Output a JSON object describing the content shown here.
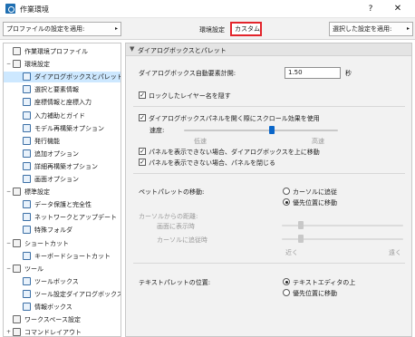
{
  "window": {
    "title": "作業環境",
    "help": "?",
    "close": "✕"
  },
  "toolbar": {
    "profile_button": "プロファイルの設定を適用:",
    "env_label": "環境設定",
    "env_value": "カスタム",
    "apply_button": "選択した設定を適用:",
    "arrow": "▸"
  },
  "tree": [
    {
      "label": "作業環境プロファイル",
      "indent": 0,
      "expander": "",
      "icon": true
    },
    {
      "label": "環境設定",
      "indent": 0,
      "expander": "−",
      "icon": true
    },
    {
      "label": "ダイアログボックスとパレット",
      "indent": 1,
      "expander": "",
      "icon": true,
      "selected": true
    },
    {
      "label": "選択と要素情報",
      "indent": 1,
      "expander": "",
      "icon": true
    },
    {
      "label": "座標情報と座標入力",
      "indent": 1,
      "expander": "",
      "icon": true
    },
    {
      "label": "入力補助とガイド",
      "indent": 1,
      "expander": "",
      "icon": true
    },
    {
      "label": "モデル再構築オプション",
      "indent": 1,
      "expander": "",
      "icon": true
    },
    {
      "label": "発行機能",
      "indent": 1,
      "expander": "",
      "icon": true
    },
    {
      "label": "追加オプション",
      "indent": 1,
      "expander": "",
      "icon": true
    },
    {
      "label": "詳細再構築オプション",
      "indent": 1,
      "expander": "",
      "icon": true
    },
    {
      "label": "画面オプション",
      "indent": 1,
      "expander": "",
      "icon": true
    },
    {
      "label": "標準設定",
      "indent": 0,
      "expander": "−",
      "icon": true
    },
    {
      "label": "データ保護と完全性",
      "indent": 1,
      "expander": "",
      "icon": true
    },
    {
      "label": "ネットワークとアップデート",
      "indent": 1,
      "expander": "",
      "icon": true
    },
    {
      "label": "特殊フォルダ",
      "indent": 1,
      "expander": "",
      "icon": true
    },
    {
      "label": "ショートカット",
      "indent": 0,
      "expander": "−",
      "icon": true
    },
    {
      "label": "キーボードショートカット",
      "indent": 1,
      "expander": "",
      "icon": true
    },
    {
      "label": "ツール",
      "indent": 0,
      "expander": "−",
      "icon": true
    },
    {
      "label": "ツールボックス",
      "indent": 1,
      "expander": "",
      "icon": true
    },
    {
      "label": "ツール設定ダイアログボックス",
      "indent": 1,
      "expander": "",
      "icon": true
    },
    {
      "label": "情報ボックス",
      "indent": 1,
      "expander": "",
      "icon": true
    },
    {
      "label": "ワークスペース設定",
      "indent": 0,
      "expander": "",
      "icon": true
    },
    {
      "label": "コマンドレイアウト",
      "indent": 0,
      "expander": "+",
      "icon": true
    }
  ],
  "panel": {
    "section_title": "ダイアログボックスとパレット",
    "section_chev": "▼",
    "auto_close_label": "ダイアログボックス自動要素計開:",
    "auto_close_value": "1.50",
    "auto_close_unit": "秒",
    "check_layer_name": {
      "label": "ロックしたレイヤー名を隠す",
      "checked": true
    },
    "check_scroll": {
      "label": "ダイアログボックスパネルを開く際にスクロール効果を使用",
      "checked": true
    },
    "speed_label": "速度:",
    "speed_slow": "低速",
    "speed_fast": "高速",
    "speed_fraction": 0.57,
    "check_move_up": {
      "label": "パネルを表示できない場合、ダイアログボックスを上に移動",
      "checked": true
    },
    "check_close_panel": {
      "label": "パネルを表示できない場合、パネルを閉じる",
      "checked": true
    },
    "pet_palette_label": "ペットパレットの移動:",
    "pet_opt1": "カーソルに追従",
    "pet_opt2": "優先位置に移動",
    "pet_selected": 2,
    "cursor_distance_label": "カーソルからの距離:",
    "show_when_label": "画面に表示時",
    "cursor_follow_label": "カーソルに追従時",
    "near_label": "近く",
    "far_label": "遠く",
    "text_palette_label": "テキストパレットの位置:",
    "text_opt1": "テキストエディタの上",
    "text_opt2": "優先位置に移動",
    "text_selected": 1,
    "check_mark": "✓"
  }
}
